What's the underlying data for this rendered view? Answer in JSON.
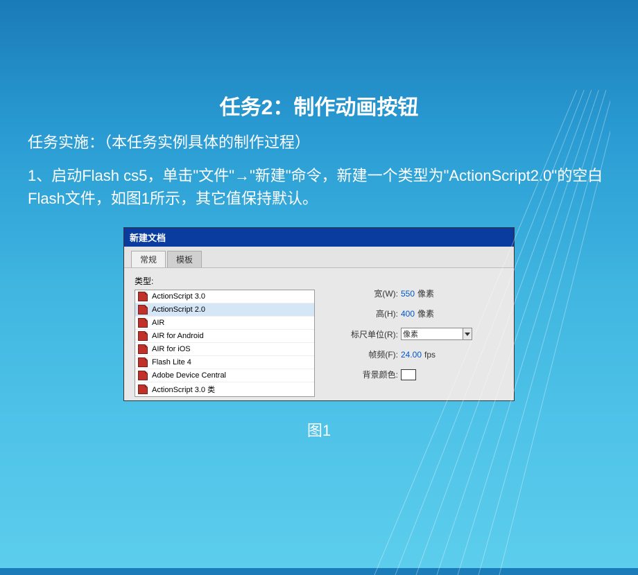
{
  "slide": {
    "title": "任务2：制作动画按钮",
    "intro": "任务实施：（本任务实例具体的制作过程）",
    "step1": "1、启动Flash cs5，单击\"文件\"→\"新建\"命令，新建一个类型为\"ActionScript2.0\"的空白Flash文件，如图1所示，其它值保持默认。",
    "caption": "图1"
  },
  "dialog": {
    "titlebar": "新建文档",
    "tabs": {
      "general": "常规",
      "template": "模板"
    },
    "type_label": "类型:",
    "types": [
      {
        "label": "ActionScript 3.0",
        "selected": false
      },
      {
        "label": "ActionScript 2.0",
        "selected": true
      },
      {
        "label": "AIR",
        "selected": false
      },
      {
        "label": "AIR for Android",
        "selected": false
      },
      {
        "label": "AIR for iOS",
        "selected": false
      },
      {
        "label": "Flash Lite 4",
        "selected": false
      },
      {
        "label": "Adobe Device Central",
        "selected": false
      },
      {
        "label": "ActionScript 3.0 类",
        "selected": false
      }
    ],
    "props": {
      "width": {
        "label": "宽(W):",
        "value": "550",
        "unit": "像素"
      },
      "height": {
        "label": "高(H):",
        "value": "400",
        "unit": "像素"
      },
      "ruler": {
        "label": "标尺单位(R):",
        "value": "像素"
      },
      "fps": {
        "label": "帧频(F):",
        "value": "24.00",
        "unit": "fps"
      },
      "bg": {
        "label": "背景颜色:",
        "color": "#ffffff"
      }
    }
  }
}
